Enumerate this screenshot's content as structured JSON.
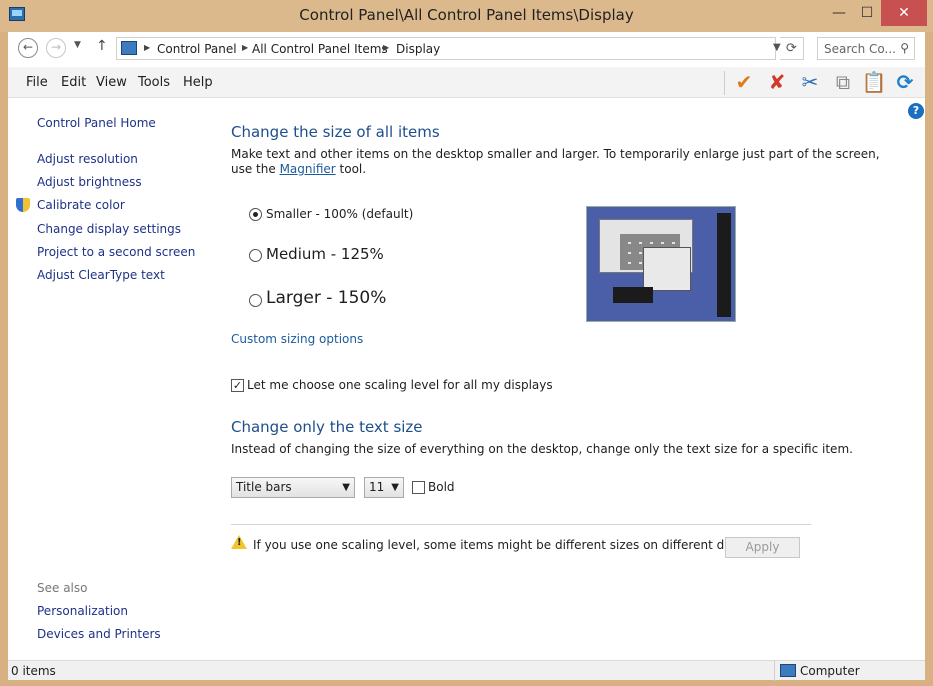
{
  "window": {
    "title": "Control Panel\\All Control Panel Items\\Display",
    "minimize": "—",
    "maximize": "☐",
    "close": "✕"
  },
  "address": {
    "crumbs": [
      "Control Panel",
      "All Control Panel Items",
      "Display"
    ],
    "search_placeholder": "Search Co..."
  },
  "menu": [
    "File",
    "Edit",
    "View",
    "Tools",
    "Help"
  ],
  "toolbar": {
    "check_icon": "✔",
    "delete_icon": "✘",
    "cut_icon": "✂",
    "copy_icon": "⧉",
    "paste_icon": "📋",
    "refresh_icon": "⟳"
  },
  "sidebar": {
    "home": "Control Panel Home",
    "links": [
      "Adjust resolution",
      "Adjust brightness",
      "Calibrate color",
      "Change display settings",
      "Project to a second screen",
      "Adjust ClearType text"
    ],
    "see_also_label": "See also",
    "see_also": [
      "Personalization",
      "Devices and Printers"
    ]
  },
  "main": {
    "heading1": "Change the size of all items",
    "desc1_line1": "Make text and other items on the desktop smaller and larger. To temporarily enlarge just part of the screen,",
    "desc1_pre": "use the ",
    "desc1_link": "Magnifier",
    "desc1_post": " tool.",
    "options": [
      {
        "label": "Smaller - 100% (default)",
        "selected": true
      },
      {
        "label": "Medium - 125%",
        "selected": false
      },
      {
        "label": "Larger - 150%",
        "selected": false
      }
    ],
    "custom_link": "Custom sizing options",
    "scaling_checkbox": "Let me choose one scaling level for all my displays",
    "scaling_checked": true,
    "heading2": "Change only the text size",
    "desc2": "Instead of changing the size of everything on the desktop, change only the text size for a specific item.",
    "item_select": "Title bars",
    "size_select": "11",
    "bold_label": "Bold",
    "bold_checked": false,
    "warning": "If you use one scaling level, some items might be different sizes on different displays.",
    "apply": "Apply"
  },
  "status": {
    "items": "0 items",
    "location": "Computer"
  }
}
